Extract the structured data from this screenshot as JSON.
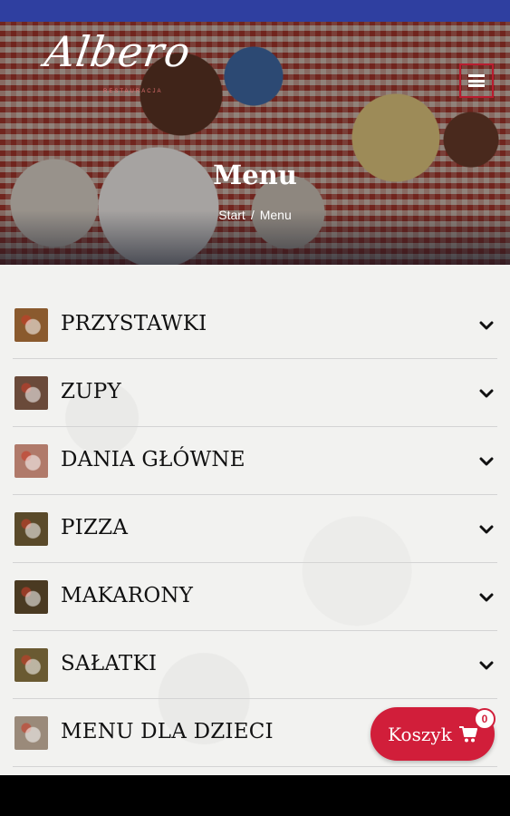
{
  "colors": {
    "status_bar": "#2f3fa0",
    "accent": "#d11e3a",
    "text": "#111111",
    "background": "#f2f2f0"
  },
  "header": {
    "logo_text": "Albero",
    "logo_subtitle": "RESTAURACJA",
    "title": "Menu",
    "breadcrumb": {
      "home": "Start",
      "separator": "/",
      "current": "Menu"
    },
    "menu_icon": "hamburger-icon"
  },
  "categories": [
    {
      "label": "PRZYSTAWKI",
      "thumb_color": "#8a5a2e",
      "icon": "chevron-down-icon"
    },
    {
      "label": "ZUPY",
      "thumb_color": "#6a4a3a",
      "icon": "chevron-down-icon"
    },
    {
      "label": "DANIA GŁÓWNE",
      "thumb_color": "#b07a6a",
      "icon": "chevron-down-icon"
    },
    {
      "label": "PIZZA",
      "thumb_color": "#5a4a2a",
      "icon": "chevron-down-icon"
    },
    {
      "label": "MAKARONY",
      "thumb_color": "#4a3a22",
      "icon": "chevron-down-icon"
    },
    {
      "label": "SAŁATKI",
      "thumb_color": "#6a5a32",
      "icon": "chevron-down-icon"
    },
    {
      "label": "MENU DLA DZIECI",
      "thumb_color": "#9a8a7a",
      "icon": "chevron-down-icon"
    }
  ],
  "cart": {
    "label": "Koszyk",
    "count": "0",
    "icon": "cart-icon"
  }
}
